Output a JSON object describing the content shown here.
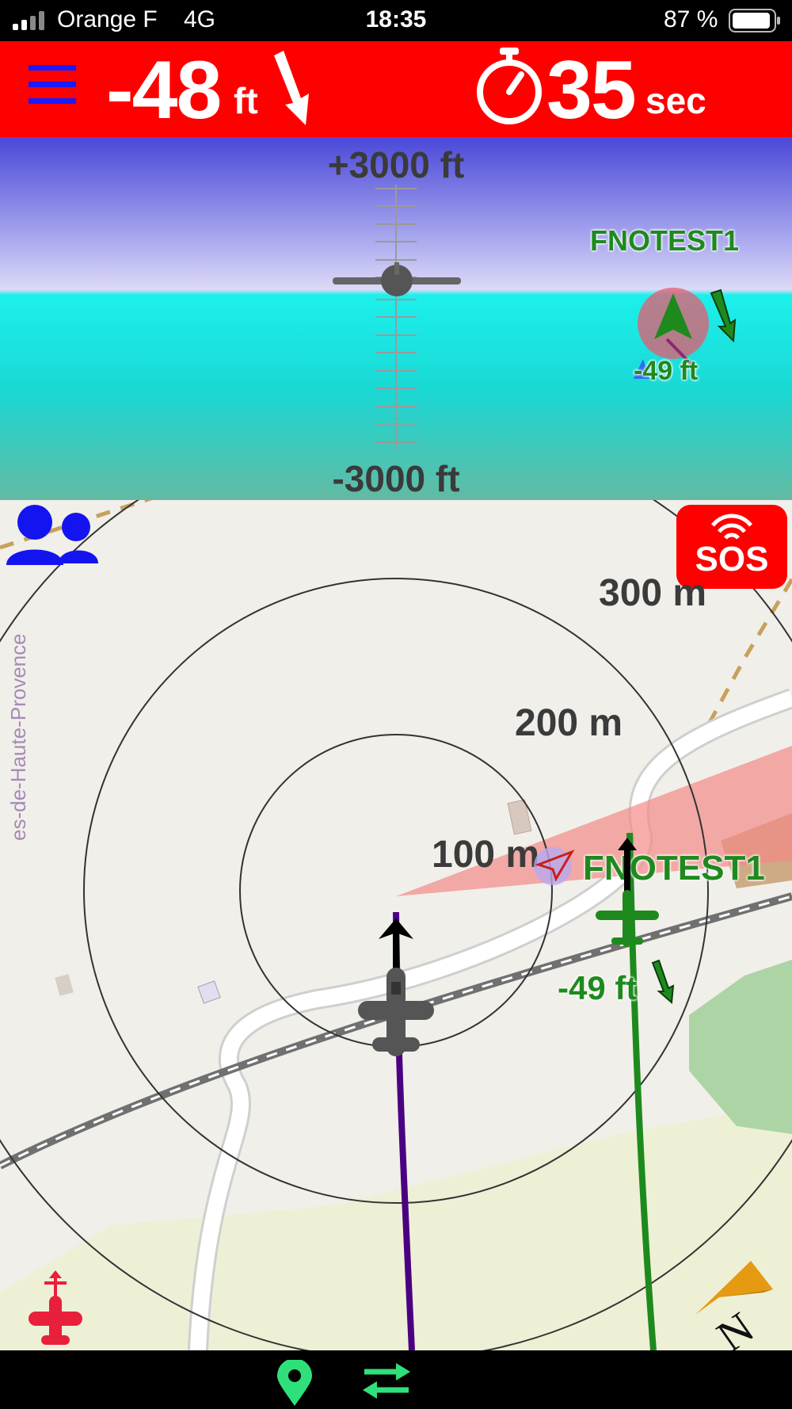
{
  "status_bar": {
    "carrier": "Orange F",
    "network": "4G",
    "time": "18:35",
    "battery": "87 %",
    "signal_icon": "cellular-signal-icon",
    "battery_icon": "battery-icon"
  },
  "alert_bar": {
    "menu_icon": "hamburger-menu-icon",
    "vertical_separation": "-48",
    "vertical_unit": "ft",
    "trend_icon": "descending-arrow-icon",
    "timer_icon": "stopwatch-icon",
    "time_to_impact": "35",
    "time_unit": "sec",
    "background": "#ff0000"
  },
  "altitude_view": {
    "top_label": "+3000 ft",
    "bottom_label": "-3000 ft",
    "target": {
      "callsign": "FNOTEST1",
      "relative_alt": "-49 ft",
      "trend_icon": "descending-arrow-icon"
    }
  },
  "map": {
    "contacts_icon": "group-icon",
    "sos_label": "SOS",
    "sos_color": "#ff0000",
    "rings": [
      "300 m",
      "200 m",
      "100 m"
    ],
    "road_label": "es-de-Haute-Provence",
    "target": {
      "callsign": "FNOTEST1",
      "relative_alt": "-49 ft",
      "color": "#1e8a1e"
    },
    "own_track_color": "#4b0082",
    "compass_icon": "north-compass-icon",
    "own_aircraft_icon": "red-aircraft-icon"
  },
  "bottom_bar": {
    "location_icon": "location-pin-icon",
    "swap_icon": "swap-arrows-icon",
    "accent": "#2fe07a"
  }
}
